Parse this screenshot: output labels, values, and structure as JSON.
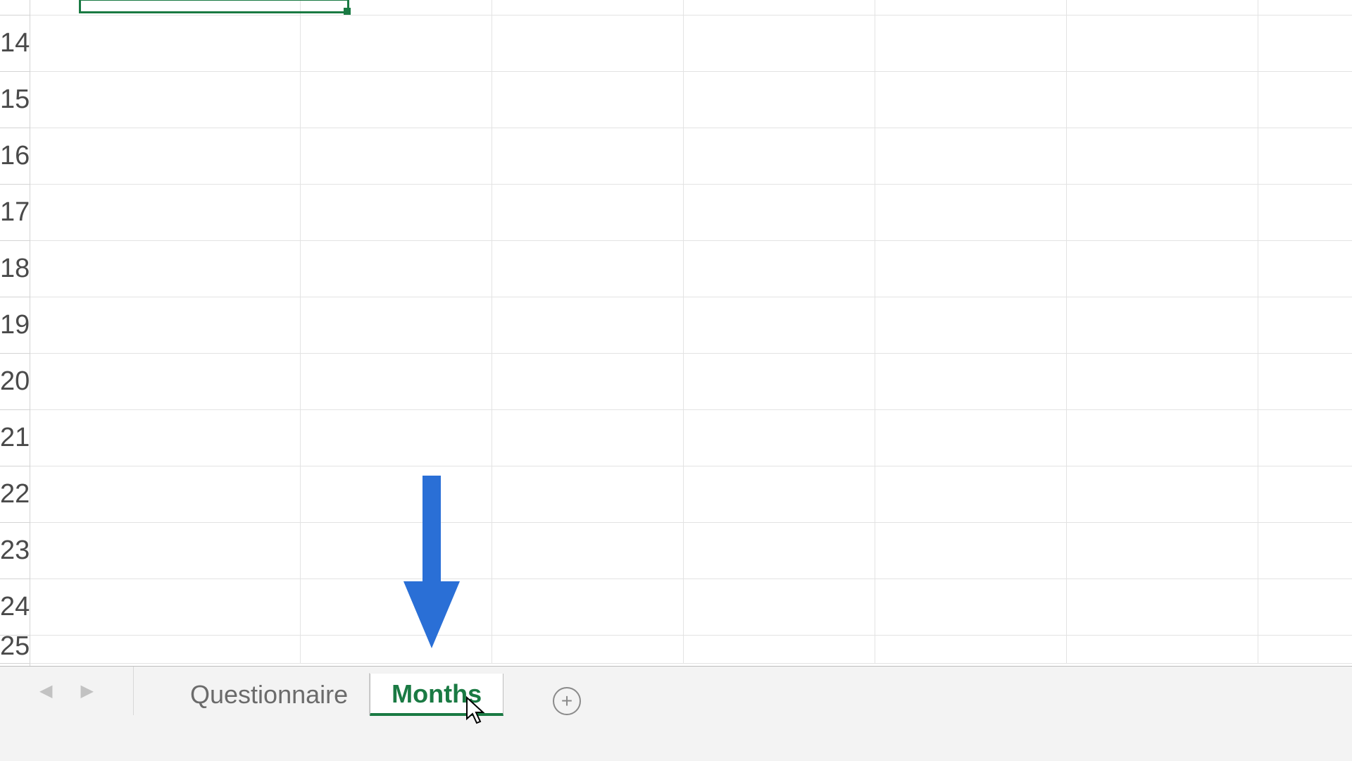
{
  "rows": [
    "",
    "14",
    "15",
    "16",
    "17",
    "18",
    "19",
    "20",
    "21",
    "22",
    "23",
    "24",
    "25"
  ],
  "tabs": {
    "items": [
      {
        "label": "Questionnaire",
        "active": false
      },
      {
        "label": "Months",
        "active": true
      }
    ],
    "new_sheet_icon": "plus-circle"
  },
  "nav": {
    "prev": "◀",
    "next": "▶"
  },
  "annotation": {
    "type": "arrow-down",
    "color": "#2a6fd6"
  },
  "colors": {
    "accent": "#1a7a43",
    "arrow": "#2a6fd6"
  }
}
